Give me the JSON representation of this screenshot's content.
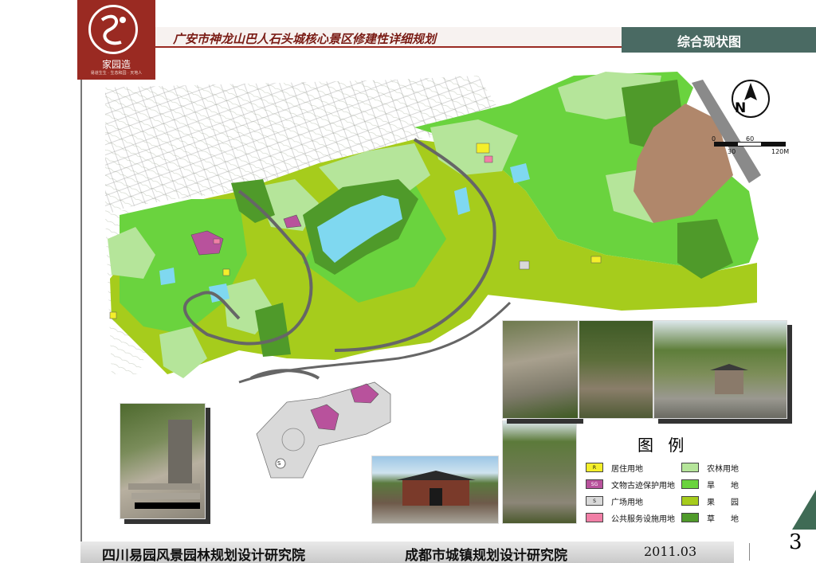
{
  "header": {
    "logo_name": "家园造",
    "logo_tagline": "易道生生 · 生态和园 · 天地人",
    "project_title": "广安市神龙山巴人石头城核心景区修建性详细规划",
    "sheet_title": "综合现状图"
  },
  "map": {
    "north_label": "N",
    "scale_labels": [
      "0",
      "30",
      "60",
      "120M"
    ],
    "plaza_mark": "S"
  },
  "legend": {
    "title": "图 例",
    "items": [
      {
        "label": "居住用地",
        "color": "#f4ef2a",
        "mark": "R"
      },
      {
        "label": "文物古迹保护用地",
        "color": "#b8529c",
        "mark": "SG"
      },
      {
        "label": "广场用地",
        "color": "#d9d9d9",
        "mark": "S"
      },
      {
        "label": "公共服务设施用地",
        "color": "#f17fa6",
        "mark": ""
      },
      {
        "label": "农林用地",
        "color": "#b5e59a",
        "mark": ""
      },
      {
        "label": "旱　　地",
        "color": "#6ad33e",
        "mark": ""
      },
      {
        "label": "果　　园",
        "color": "#a6cc1c",
        "mark": ""
      },
      {
        "label": "草　　地",
        "color": "#4f9a2a",
        "mark": ""
      }
    ]
  },
  "page_number": "3",
  "footer": {
    "org1": "四川易园风景园林规划设计研究院",
    "org2": "成都市城镇规划设计研究院",
    "date": "2011.03"
  }
}
